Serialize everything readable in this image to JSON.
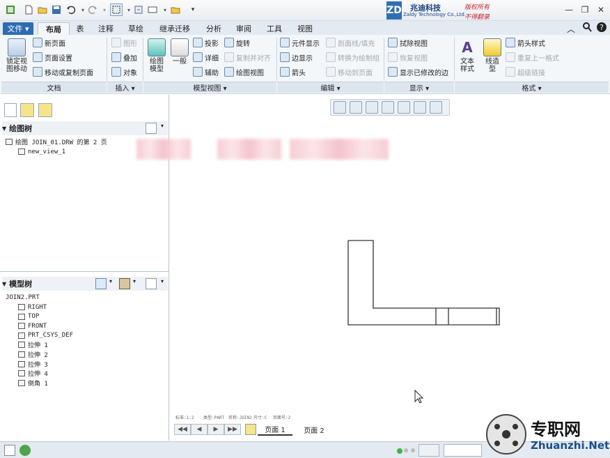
{
  "window": {
    "min": "—",
    "restore": "❐",
    "close": "✕"
  },
  "logo": {
    "mark": "ZD",
    "name_cn": "兆迪科技",
    "name_en": "Zaldy Technology Co.,Ltd.",
    "right1": "版权所有",
    "right2": "不得翻录"
  },
  "tabs": [
    {
      "label": "文件 ▾"
    },
    {
      "label": "布局"
    },
    {
      "label": "表"
    },
    {
      "label": "注释"
    },
    {
      "label": "草绘"
    },
    {
      "label": "继承迁移"
    },
    {
      "label": "分析"
    },
    {
      "label": "审阅"
    },
    {
      "label": "工具"
    },
    {
      "label": "视图"
    }
  ],
  "ribbon": {
    "doc": {
      "lock": "锁定视\n图移动",
      "new_page": "新页面",
      "page_setup": "页面设置",
      "move_copy": "移动或复制页面",
      "group": "文档"
    },
    "insert": {
      "graphic": "图形",
      "overlay": "叠加",
      "object": "对象",
      "group": "插入 ▾"
    },
    "model_view": {
      "drawing_model": "绘图\n模型",
      "general": "一般",
      "projection": "投影",
      "detail": "详细",
      "auxiliary": "辅助",
      "rotate": "旋转",
      "copy_align": "复制并对齐",
      "drawing_view": "绘图视图",
      "group": "模型视图 ▾"
    },
    "edit": {
      "component_display": "元件显示",
      "edge_display": "边显示",
      "arrow": "箭头",
      "xsec": "剖面线/填充",
      "convert": "转换为绘制组",
      "move_page": "移动到页面",
      "group": "编辑 ▾"
    },
    "display": {
      "erase": "拭除视图",
      "restore": "恢复视图",
      "show_modified": "显示已修改的边",
      "group": "显示 ▾"
    },
    "format": {
      "text_style": "文本\n样式",
      "line_style": "线造\n型",
      "arrow_style": "箭头样式",
      "repeat": "重复上一格式",
      "hyperlink": "超级链接",
      "group": "格式 ▾"
    }
  },
  "drawing_tree": {
    "title": "绘图树",
    "root": "绘图 JOIN_01.DRW 的第 2 页",
    "child": "new_view_1"
  },
  "model_tree": {
    "title": "模型树",
    "root": "JOIN2.PRT",
    "items": [
      "RIGHT",
      "TOP",
      "FRONT",
      "PRT_CSYS_DEF",
      "拉伸 1",
      "拉伸 2",
      "拉伸 3",
      "拉伸 4",
      "倒角 1"
    ]
  },
  "canvas": {
    "footnotes": [
      "标准:1:2",
      "类型:PART",
      "名称:JOIN2",
      "尺寸:C",
      "页面号:2"
    ]
  },
  "pages": {
    "page1": "页面 1",
    "page2": "页面 2",
    "nav": [
      "◀◀",
      "◀",
      "▶",
      "▶▶"
    ]
  },
  "watermark": {
    "cn": "专职网",
    "en": "Zhuanzhi.Net"
  }
}
